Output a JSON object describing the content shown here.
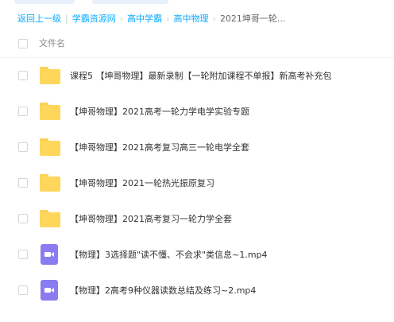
{
  "breadcrumb": {
    "back": "返回上一级",
    "divider": "|",
    "items": [
      "学霸资源网",
      "高中学霸",
      "高中物理"
    ],
    "current": "2021坤哥一轮..."
  },
  "list_header": {
    "column_name": "文件名"
  },
  "files": [
    {
      "name": "课程5 【坤哥物理】最新录制【一轮附加课程不单报】新高考补充包",
      "icon": "folder-icon"
    },
    {
      "name": "【坤哥物理】2021高考一轮力学电学实验专题",
      "icon": "folder-icon"
    },
    {
      "name": "【坤哥物理】2021高考复习高三一轮电学全套",
      "icon": "folder-icon"
    },
    {
      "name": "【坤哥物理】2021一轮热光振原复习",
      "icon": "folder-icon"
    },
    {
      "name": "【坤哥物理】2021高考复习一轮力学全套",
      "icon": "folder-icon"
    },
    {
      "name": "【物理】3选择题\"读不懂、不会求\"类信息~1.mp4",
      "icon": "video-file-icon"
    },
    {
      "name": "【物理】2高考9种仪器读数总结及练习~2.mp4",
      "icon": "video-file-icon"
    }
  ],
  "colors": {
    "link": "#09aaff",
    "folder": "#ffd65c",
    "video": "#8a7cf0"
  }
}
